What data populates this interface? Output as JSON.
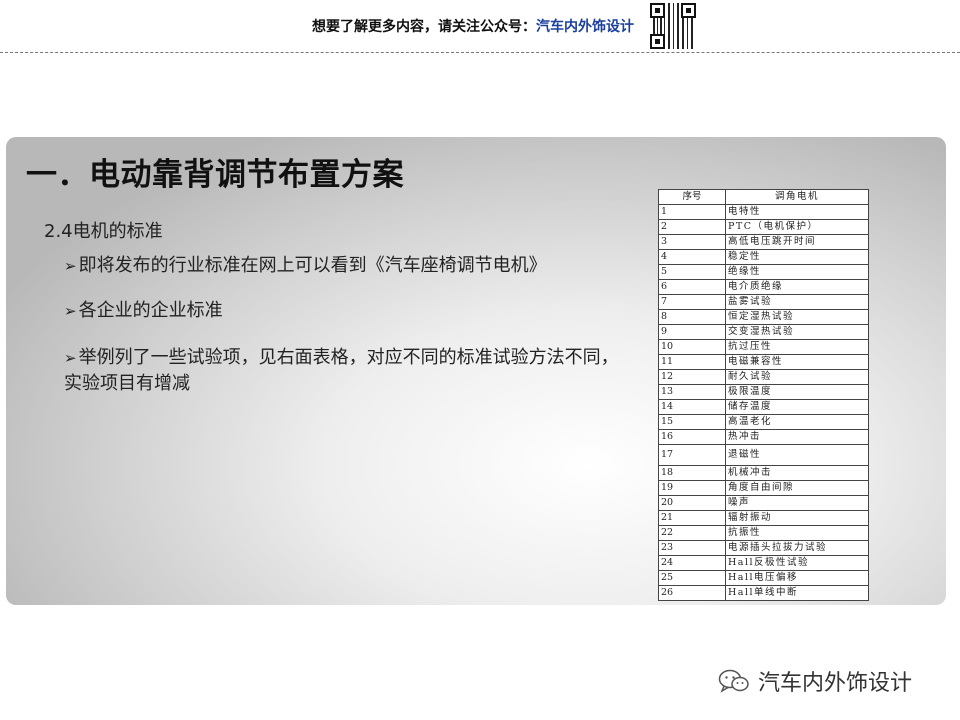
{
  "banner": {
    "prefix": "想要了解更多内容，请关注公众号：",
    "account": "汽车内外饰设计"
  },
  "slide": {
    "title": "一．电动靠背调节布置方案",
    "section": "2.4电机的标准",
    "bullets": [
      "即将发布的行业标准在网上可以看到《汽车座椅调节电机》",
      "各企业的企业标准",
      "举例列了一些试验项，见右面表格，对应不同的标准试验方法不同，实验项目有增减"
    ],
    "bullet_marker": "➢"
  },
  "table": {
    "headers": [
      "序号",
      "调角电机"
    ],
    "rows": [
      [
        "1",
        "电特性"
      ],
      [
        "2",
        "PTC（电机保护）"
      ],
      [
        "3",
        "高低电压跳开时间"
      ],
      [
        "4",
        "稳定性"
      ],
      [
        "5",
        "绝缘性"
      ],
      [
        "6",
        "电介质绝缘"
      ],
      [
        "7",
        "盐雾试验"
      ],
      [
        "8",
        "恒定湿热试验"
      ],
      [
        "9",
        "交变湿热试验"
      ],
      [
        "10",
        "抗过压性"
      ],
      [
        "11",
        "电磁兼容性"
      ],
      [
        "12",
        "耐久试验"
      ],
      [
        "13",
        "极限温度"
      ],
      [
        "14",
        "储存温度"
      ],
      [
        "15",
        "高温老化"
      ],
      [
        "16",
        "热冲击"
      ],
      [
        "17",
        "退磁性"
      ],
      [
        "18",
        "机械冲击"
      ],
      [
        "19",
        "角度自由间隙"
      ],
      [
        "20",
        "噪声"
      ],
      [
        "21",
        "辐射振动"
      ],
      [
        "22",
        "抗振性"
      ],
      [
        "23",
        "电源插头拉拔力试验"
      ],
      [
        "24",
        "Hall反极性试验"
      ],
      [
        "25",
        "Hall电压偏移"
      ],
      [
        "26",
        "Hall单线中断"
      ]
    ]
  },
  "footer": {
    "text": "汽车内外饰设计",
    "icon": "wechat-icon"
  }
}
